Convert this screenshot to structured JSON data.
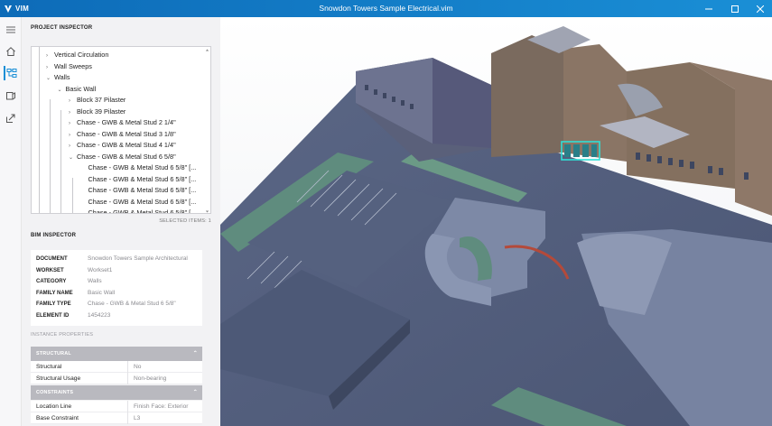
{
  "app": {
    "logo_text": "VIM",
    "window_title": "Snowdon Towers Sample Electrical.vim"
  },
  "window_controls": [
    "minimize",
    "maximize",
    "close"
  ],
  "rail": [
    "hamburger-icon",
    "home-icon",
    "hierarchy-icon",
    "cube-icon",
    "share-icon"
  ],
  "project_inspector": {
    "title": "PROJECT INSPECTOR",
    "tree": [
      {
        "label": "Vertical Circulation",
        "chevron": "›"
      },
      {
        "label": "Wall Sweeps",
        "chevron": "›"
      },
      {
        "label": "Walls",
        "chevron": "⌄"
      },
      {
        "label": "Basic Wall",
        "chevron": "⌄"
      },
      {
        "label": "Block 37 Pilaster",
        "chevron": "›"
      },
      {
        "label": "Block 39 Pilaster",
        "chevron": "›"
      },
      {
        "label": "Chase - GWB & Metal Stud 2 1/4\"",
        "chevron": "›"
      },
      {
        "label": "Chase - GWB & Metal Stud 3 1/8\"",
        "chevron": "›"
      },
      {
        "label": "Chase - GWB & Metal Stud 4 1/4\"",
        "chevron": "›"
      },
      {
        "label": "Chase - GWB & Metal Stud 6 5/8\"",
        "chevron": "⌄"
      },
      {
        "label": "Chase - GWB & Metal Stud 6 5/8\" [...",
        "chevron": ""
      },
      {
        "label": "Chase - GWB & Metal Stud 6 5/8\" [...",
        "chevron": ""
      },
      {
        "label": "Chase - GWB & Metal Stud 6 5/8\" [...",
        "chevron": ""
      },
      {
        "label": "Chase - GWB & Metal Stud 6 5/8\" [...",
        "chevron": ""
      },
      {
        "label": "Chase - GWB & Metal Stud 6 5/8\" [...",
        "chevron": ""
      }
    ],
    "selected_items": "SELECTED ITEMS: 1"
  },
  "bim_inspector": {
    "title": "BIM INSPECTOR",
    "rows": [
      {
        "key": "DOCUMENT",
        "value": "Snowdon Towers Sample Architectural"
      },
      {
        "key": "WORKSET",
        "value": "Workset1"
      },
      {
        "key": "CATEGORY",
        "value": "Walls"
      },
      {
        "key": "FAMILY NAME",
        "value": "Basic Wall"
      },
      {
        "key": "FAMILY TYPE",
        "value": "Chase - GWB & Metal Stud 6 5/8\""
      },
      {
        "key": "ELEMENT ID",
        "value": "1454223"
      }
    ]
  },
  "instance_properties": {
    "title": "INSTANCE PROPERTIES",
    "groups": [
      {
        "name": "STRUCTURAL",
        "caret": "⌃",
        "rows": [
          {
            "key": "Structural",
            "value": "No"
          },
          {
            "key": "Structural Usage",
            "value": "Non-bearing"
          }
        ]
      },
      {
        "name": "CONSTRAINTS",
        "caret": "⌃",
        "rows": [
          {
            "key": "Location Line",
            "value": "Finish Face: Exterior"
          },
          {
            "key": "Base Constraint",
            "value": "L3"
          }
        ]
      }
    ]
  },
  "colors": {
    "titlebar": "#1a8fd6",
    "accent": "#1a8fd6",
    "highlight": "#2fe0d6"
  }
}
